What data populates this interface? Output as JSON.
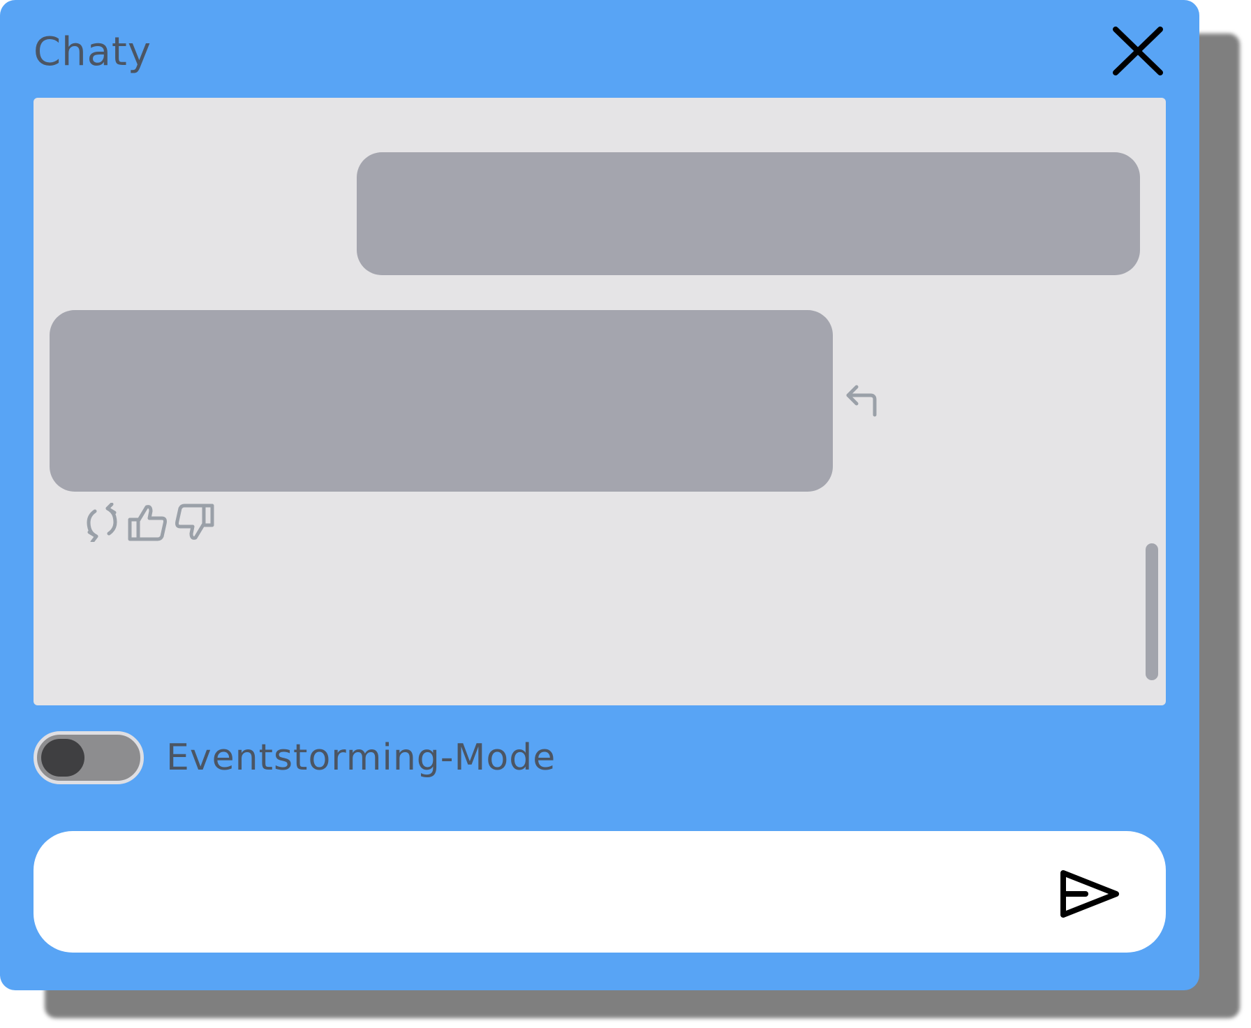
{
  "header": {
    "title": "Chaty",
    "close_icon": "close-icon"
  },
  "messages": {
    "items": [
      {
        "role": "user",
        "text": ""
      },
      {
        "role": "assistant",
        "text": ""
      }
    ],
    "reply_icon": "reply-arrow-icon",
    "actions": [
      "regenerate-icon",
      "thumbs-up-icon",
      "thumbs-down-icon"
    ]
  },
  "mode": {
    "label": "Eventstorming-Mode",
    "enabled": false
  },
  "composer": {
    "value": "",
    "placeholder": "",
    "send_icon": "send-icon"
  },
  "colors": {
    "panel": "#58a4f5",
    "messages_bg": "#e5e4e6",
    "bubble": "#a4a5ae",
    "text": "#4b5563",
    "toggle_track": "#8d8d8f",
    "toggle_knob": "#3f3f41"
  }
}
